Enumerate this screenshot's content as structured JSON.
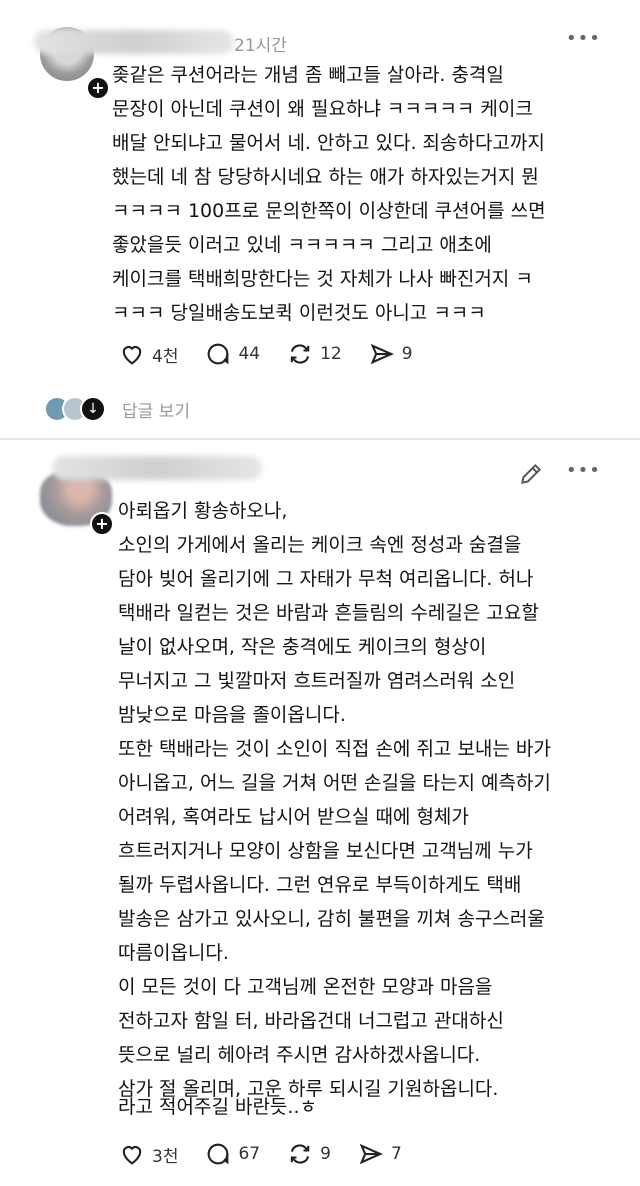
{
  "post1": {
    "time": "21시간",
    "lines": [
      "좆같은 쿠션어라는 개념 좀 빼고들 살아라. 충격일",
      "문장이 아닌데 쿠션이 왜 필요하냐 ㅋㅋㅋㅋㅋ 케이크",
      "배달 안되냐고 물어서 네. 안하고 있다. 죄송하다고까지",
      "했는데 네 참 당당하시네요 하는 애가 하자있는거지 뭔",
      "ㅋㅋㅋㅋ 100프로 문의한쪽이 이상한데 쿠션어를 쓰면",
      "좋았을듯 이러고 있네 ㅋㅋㅋㅋㅋ 그리고 애초에",
      "케이크를 택배희망한다는 것 자체가 나사 빠진거지 ㅋ",
      "ㅋㅋㅋ 당일배송도보퀵 이런것도 아니고 ㅋㅋㅋ"
    ],
    "likes": "4천",
    "comments": "44",
    "reposts": "12",
    "shares": "9",
    "replies_label": "답글 보기"
  },
  "post2": {
    "lines": [
      "아뢰옵기 황송하오나,",
      "소인의 가게에서 올리는 케이크 속엔 정성과 숨결을",
      "담아 빚어 올리기에 그 자태가 무척 여리옵니다. 허나",
      "택배라 일컫는 것은 바람과 흔들림의 수레길은 고요할",
      "날이 없사오며, 작은 충격에도 케이크의 형상이",
      "무너지고 그 빛깔마저 흐트러질까 염려스러워 소인",
      "밤낮으로 마음을 졸이옵니다.",
      "또한 택배라는 것이 소인이 직접 손에 쥐고 보내는 바가",
      "아니옵고, 어느 길을 거쳐 어떤 손길을 타는지 예측하기",
      "어려워, 혹여라도 납시어 받으실 때에 형체가",
      "흐트러지거나 모양이 상함을 보신다면 고객님께 누가",
      "될까 두렵사옵니다. 그런 연유로 부득이하게도 택배",
      "발송은 삼가고 있사오니, 감히 불편을 끼쳐 송구스러울",
      "따름이옵니다.",
      "이 모든 것이 다 고객님께 온전한 모양과 마음을",
      "전하고자 함일 터, 바라옵건대 너그럽고 관대하신",
      "뜻으로 널리 헤아려 주시면 감사하겠사옵니다.",
      "삼가 절 올리며, 고운 하루 되시길 기원하옵니다."
    ],
    "closing": "라고 적어주길 바란듯..ㅎ",
    "likes": "3천",
    "comments": "67",
    "reposts": "9",
    "shares": "7"
  },
  "icons": {
    "follow": "plus-icon",
    "more": "more-icon",
    "edit": "pencil-icon",
    "like": "heart-icon",
    "comment": "comment-icon",
    "repost": "repost-icon",
    "share": "share-icon"
  }
}
